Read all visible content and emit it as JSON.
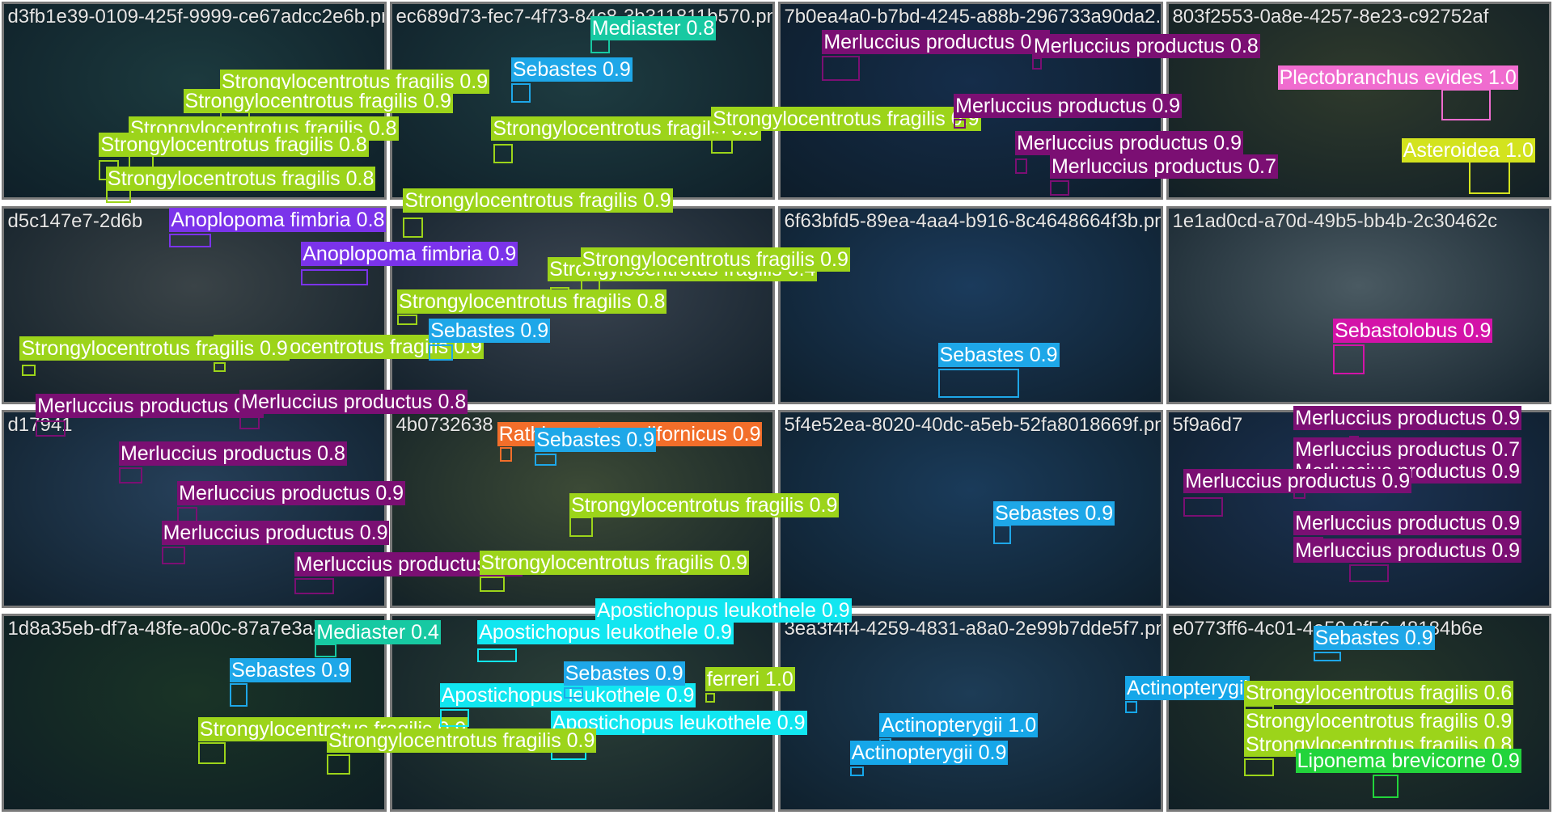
{
  "colors": {
    "Strongylocentrotus": "#9cd41a",
    "Merluccius": "#7b0f73",
    "Sebastes": "#1ea7e8",
    "Mediaster": "#17c9a2",
    "Anoplopoma": "#7b33ea",
    "Apostichopus": "#11e6f0",
    "Actinopterygii": "#16a7e9",
    "Plectobranchus": "#f06ccf",
    "Asteroidea": "#d3e31e",
    "Sebastolobus": "#d313a8",
    "Rathbunaster": "#f26e2a",
    "Liponema": "#22d43b"
  },
  "tiles": [
    {
      "title": "d3fb1e39-0109-425f-9999-ce67adcc2e6b.png",
      "bg": "#1c3a3e"
    },
    {
      "title": "ec689d73-fec7-4f73-84c8-3b311811b570.png",
      "bg": "#1e3c41"
    },
    {
      "title": "7b0ea4a0-b7bd-4245-a88b-296733a90da2.png",
      "bg": "#152d4a"
    },
    {
      "title": "803f2553-0a8e-4257-8e23-c92752af",
      "bg": "#2f3a2c"
    },
    {
      "title": "d5c147e7-2d6b",
      "bg": "#3a4347"
    },
    {
      "title": "",
      "bg": "#3a4450"
    },
    {
      "title": "6f63bfd5-89ea-4aa4-b916-8c4648664f3b.png",
      "bg": "#1b3b5c"
    },
    {
      "title": "1e1ad0cd-a70d-49b5-bb4b-2c30462c",
      "bg": "#4a5a62"
    },
    {
      "title": "d17941",
      "bg": "#26405a"
    },
    {
      "title": "4b0732638",
      "bg": "#3c4a36"
    },
    {
      "title": "5f4e52ea-8020-40dc-a5eb-52fa8018669f.png",
      "bg": "#1a3b5a"
    },
    {
      "title": "5f9a6d7",
      "bg": "#1c3354"
    },
    {
      "title": "1d8a35eb-df7a-48fe-a00c-87a7e3a41c6e.png",
      "bg": "#1a3426"
    },
    {
      "title": "",
      "bg": "#2c4038"
    },
    {
      "title": "3ea3f4f4-4259-4831-a8a0-2e99b7dde5f7.png",
      "bg": "#1d3c56"
    },
    {
      "title": "e0773ff6-4c01-4e50-8f56-48184b6e",
      "bg": "#26372a"
    }
  ],
  "detections": [
    {
      "label": "Strongylocentrotus fragilis 0.9",
      "sp": "Strongylocentrotus"
    },
    {
      "label": "Strongylocentrotus fragilis 0.9",
      "sp": "Strongylocentrotus"
    },
    {
      "label": "Strongylocentrotus fragilis 0.8",
      "sp": "Strongylocentrotus"
    },
    {
      "label": "Strongylocentrotus fragilis 0.8",
      "sp": "Strongylocentrotus"
    },
    {
      "label": "Strongylocentrotus fragilis 0.8",
      "sp": "Strongylocentrotus"
    },
    {
      "label": "Strongylocentrotus fragilis 0.9",
      "sp": "Strongylocentrotus"
    },
    {
      "label": "Mediaster 0.8",
      "sp": "Mediaster"
    },
    {
      "label": "Sebastes 0.9",
      "sp": "Sebastes"
    },
    {
      "label": "Strongylocentrotus fragilis 0.9",
      "sp": "Strongylocentrotus"
    },
    {
      "label": "Strongylocentrotus fragilis 0.9",
      "sp": "Strongylocentrotus"
    },
    {
      "label": "Merluccius productus 0.8",
      "sp": "Merluccius"
    },
    {
      "label": "Merluccius productus 0.8",
      "sp": "Merluccius"
    },
    {
      "label": "Merluccius productus 0.9",
      "sp": "Merluccius"
    },
    {
      "label": "Merluccius productus 0.9",
      "sp": "Merluccius"
    },
    {
      "label": "Merluccius productus 0.7",
      "sp": "Merluccius"
    },
    {
      "label": "Plectobranchus evides 1.0",
      "sp": "Plectobranchus"
    },
    {
      "label": "Asteroidea 1.0",
      "sp": "Asteroidea"
    },
    {
      "label": "Anoplopoma fimbria 0.8",
      "sp": "Anoplopoma"
    },
    {
      "label": "Anoplopoma fimbria 0.9",
      "sp": "Anoplopoma"
    },
    {
      "label": "Strongylocentrotus fragilis 0.4",
      "sp": "Strongylocentrotus"
    },
    {
      "label": "Strongylocentrotus fragilis 0.9",
      "sp": "Strongylocentrotus"
    },
    {
      "label": "Strongylocentrotus fragilis 0.8",
      "sp": "Strongylocentrotus"
    },
    {
      "label": "Strongylocentrotus fragilis 0.9",
      "sp": "Strongylocentrotus"
    },
    {
      "label": "Sebastes 0.9",
      "sp": "Sebastes"
    },
    {
      "label": "Strongylocentrotus fragilis 0.9",
      "sp": "Strongylocentrotus"
    },
    {
      "label": "Sebastes 0.9",
      "sp": "Sebastes"
    },
    {
      "label": "Sebastolobus 0.9",
      "sp": "Sebastolobus"
    },
    {
      "label": "Merluccius productus 0.8",
      "sp": "Merluccius"
    },
    {
      "label": "Merluccius productus 0.8",
      "sp": "Merluccius"
    },
    {
      "label": "Merluccius productus 0.8",
      "sp": "Merluccius"
    },
    {
      "label": "Merluccius productus 0.9",
      "sp": "Merluccius"
    },
    {
      "label": "Merluccius productus 0.9",
      "sp": "Merluccius"
    },
    {
      "label": "Merluccius productus 0.9",
      "sp": "Merluccius"
    },
    {
      "label": "Rathbunaster californicus 0.9",
      "sp": "Rathbunaster"
    },
    {
      "label": "Sebastes 0.9",
      "sp": "Sebastes"
    },
    {
      "label": "Strongylocentrotus fragilis 0.9",
      "sp": "Strongylocentrotus"
    },
    {
      "label": "Strongylocentrotus fragilis 0.9",
      "sp": "Strongylocentrotus"
    },
    {
      "label": "Sebastes 0.9",
      "sp": "Sebastes"
    },
    {
      "label": "Merluccius productus 0.9",
      "sp": "Merluccius"
    },
    {
      "label": "Merluccius productus 0.7",
      "sp": "Merluccius"
    },
    {
      "label": "Merluccius productus 0.9",
      "sp": "Merluccius"
    },
    {
      "label": "Merluccius productus 0.9",
      "sp": "Merluccius"
    },
    {
      "label": "Merluccius productus 0.9",
      "sp": "Merluccius"
    },
    {
      "label": "Merluccius productus 0.9",
      "sp": "Merluccius"
    },
    {
      "label": "Mediaster 0.4",
      "sp": "Mediaster"
    },
    {
      "label": "Sebastes 0.9",
      "sp": "Sebastes"
    },
    {
      "label": "Strongylocentrotus fragilis 0.9",
      "sp": "Strongylocentrotus"
    },
    {
      "label": "Apostichopus leukothele 0.9",
      "sp": "Apostichopus"
    },
    {
      "label": "Apostichopus leukothele 0.9",
      "sp": "Apostichopus"
    },
    {
      "label": "Apostichopus leukothele 0.9",
      "sp": "Apostichopus"
    },
    {
      "label": "Apostichopus leukothele 0.9",
      "sp": "Apostichopus"
    },
    {
      "label": "Sebastes 0.9",
      "sp": "Sebastes"
    },
    {
      "label": "Strongylocentrotus fragilis 0.9",
      "sp": "Strongylocentrotus"
    },
    {
      "label": "Actinopterygii 1.0",
      "sp": "Actinopterygii"
    },
    {
      "label": "Actinopterygii 0.9",
      "sp": "Actinopterygii"
    },
    {
      "label": "Actinopterygii",
      "sp": "Actinopterygii"
    },
    {
      "label": "Sebastes 0.9",
      "sp": "Sebastes"
    },
    {
      "label": "Strongylocentrotus fragilis 0.6",
      "sp": "Strongylocentrotus"
    },
    {
      "label": "Strongylocentrotus fragilis 0.9",
      "sp": "Strongylocentrotus"
    },
    {
      "label": "Strongylocentrotus fragilis 0.8",
      "sp": "Strongylocentrotus"
    },
    {
      "label": "Liponema brevicorne 0.9",
      "sp": "Liponema"
    },
    {
      "label": "ferreri 1.0",
      "sp": "Strongylocentrotus"
    }
  ]
}
